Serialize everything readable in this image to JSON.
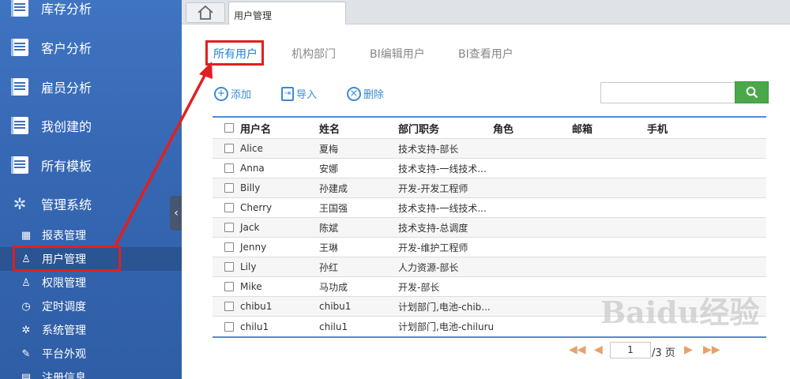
{
  "sidebar": {
    "main_items": [
      {
        "label": "库存分析"
      },
      {
        "label": "客户分析"
      },
      {
        "label": "雇员分析"
      },
      {
        "label": "我创建的"
      },
      {
        "label": "所有模板"
      },
      {
        "label": "管理系统"
      }
    ],
    "sub_items": [
      {
        "label": "报表管理",
        "icon": "report-icon"
      },
      {
        "label": "用户管理",
        "icon": "user-icon"
      },
      {
        "label": "权限管理",
        "icon": "user-icon"
      },
      {
        "label": "定时调度",
        "icon": "clock-icon"
      },
      {
        "label": "系统管理",
        "icon": "gear-icon"
      },
      {
        "label": "平台外观",
        "icon": "brush-icon"
      },
      {
        "label": "注册信息",
        "icon": "doc-icon"
      }
    ],
    "active": "用户管理",
    "collapse_glyph": "‹"
  },
  "topbar": {
    "tab_label": "用户管理"
  },
  "subtabs": [
    "所有用户",
    "机构部门",
    "BI编辑用户",
    "BI查看用户"
  ],
  "toolbar": {
    "add": "添加",
    "import": "导入",
    "delete": "删除"
  },
  "search": {
    "value": ""
  },
  "table": {
    "headers": [
      "用户名",
      "姓名",
      "部门职务",
      "角色",
      "邮箱",
      "手机"
    ],
    "rows": [
      {
        "user": "Alice",
        "name": "夏梅",
        "dept": "技术支持-部长"
      },
      {
        "user": "Anna",
        "name": "安娜",
        "dept": "技术支持-一线技术..."
      },
      {
        "user": "Billy",
        "name": "孙建成",
        "dept": "开发-开发工程师"
      },
      {
        "user": "Cherry",
        "name": "王国强",
        "dept": "技术支持-一线技术..."
      },
      {
        "user": "Jack",
        "name": "陈斌",
        "dept": "技术支持-总调度"
      },
      {
        "user": "Jenny",
        "name": "王琳",
        "dept": "开发-维护工程师"
      },
      {
        "user": "Lily",
        "name": "孙红",
        "dept": "人力资源-部长"
      },
      {
        "user": "Mike",
        "name": "马功成",
        "dept": "开发-部长"
      },
      {
        "user": "chibu1",
        "name": "chibu1",
        "dept": "计划部门,电池-chib..."
      },
      {
        "user": "chilu1",
        "name": "chilu1",
        "dept": "计划部门,电池-chiluru"
      }
    ]
  },
  "pager": {
    "current": "1",
    "total_text": "/3 页"
  },
  "watermark": "Baidu经验",
  "colors": {
    "accent": "#2a7fd4",
    "annotation": "#e02020",
    "sidebar": "#3768b4"
  }
}
